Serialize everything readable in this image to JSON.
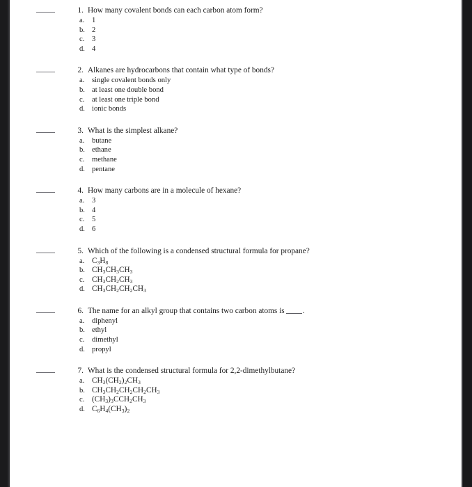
{
  "document": {
    "type": "multiple-choice-worksheet",
    "subject_hint": "organic chemistry — alkanes and alkyl groups",
    "page_background": "#ffffff",
    "text_color": "#1a1a1a",
    "scan_border_color": "#1b1b1d"
  },
  "questions": [
    {
      "number": "1.",
      "text": "How many covalent bonds can each carbon atom form?",
      "has_trailing_blank": false,
      "options": [
        {
          "letter": "a.",
          "text": "1",
          "is_formula": false
        },
        {
          "letter": "b.",
          "text": "2",
          "is_formula": false
        },
        {
          "letter": "c.",
          "text": "3",
          "is_formula": false
        },
        {
          "letter": "d.",
          "text": "4",
          "is_formula": false
        }
      ]
    },
    {
      "number": "2.",
      "text": "Alkanes are hydrocarbons that contain what type of bonds?",
      "has_trailing_blank": false,
      "options": [
        {
          "letter": "a.",
          "text": "single covalent bonds only",
          "is_formula": false
        },
        {
          "letter": "b.",
          "text": "at least one double bond",
          "is_formula": false
        },
        {
          "letter": "c.",
          "text": "at least one triple bond",
          "is_formula": false
        },
        {
          "letter": "d.",
          "text": "ionic bonds",
          "is_formula": false
        }
      ]
    },
    {
      "number": "3.",
      "text": "What is the simplest alkane?",
      "has_trailing_blank": false,
      "options": [
        {
          "letter": "a.",
          "text": "butane",
          "is_formula": false
        },
        {
          "letter": "b.",
          "text": "ethane",
          "is_formula": false
        },
        {
          "letter": "c.",
          "text": "methane",
          "is_formula": false
        },
        {
          "letter": "d.",
          "text": "pentane",
          "is_formula": false
        }
      ]
    },
    {
      "number": "4.",
      "text": "How many carbons are in a molecule of hexane?",
      "has_trailing_blank": false,
      "options": [
        {
          "letter": "a.",
          "text": "3",
          "is_formula": false
        },
        {
          "letter": "b.",
          "text": "4",
          "is_formula": false
        },
        {
          "letter": "c.",
          "text": "5",
          "is_formula": false
        },
        {
          "letter": "d.",
          "text": "6",
          "is_formula": false
        }
      ]
    },
    {
      "number": "5.",
      "text": "Which of the following is a condensed structural formula for propane?",
      "has_trailing_blank": false,
      "options": [
        {
          "letter": "a.",
          "text": "C3H8",
          "is_formula": true,
          "html": "C<sub>3</sub>H<sub>8</sub>"
        },
        {
          "letter": "b.",
          "text": "CH3CH3CH3",
          "is_formula": true,
          "html": "CH<sub>3</sub>CH<sub>3</sub>CH<sub>3</sub>"
        },
        {
          "letter": "c.",
          "text": "CH3CH2CH3",
          "is_formula": true,
          "html": "CH<sub>3</sub>CH<sub>2</sub>CH<sub>3</sub>"
        },
        {
          "letter": "d.",
          "text": "CH3CH2CH2CH3",
          "is_formula": true,
          "html": "CH<sub>3</sub>CH<sub>2</sub>CH<sub>2</sub>CH<sub>3</sub>"
        }
      ]
    },
    {
      "number": "6.",
      "text": "The name for an alkyl group that contains two carbon atoms is",
      "has_trailing_blank": true,
      "trailing_punctuation": ".",
      "options": [
        {
          "letter": "a.",
          "text": "diphenyl",
          "is_formula": false
        },
        {
          "letter": "b.",
          "text": "ethyl",
          "is_formula": false
        },
        {
          "letter": "c.",
          "text": "dimethyl",
          "is_formula": false
        },
        {
          "letter": "d.",
          "text": "propyl",
          "is_formula": false
        }
      ]
    },
    {
      "number": "7.",
      "text": "What is the condensed structural formula for 2,2-dimethylbutane?",
      "has_trailing_blank": false,
      "options": [
        {
          "letter": "a.",
          "text": "CH3(CH2)2CH3",
          "is_formula": true,
          "html": "CH<sub>3</sub>(CH<sub>2</sub>)<sub>2</sub>CH<sub>3</sub>"
        },
        {
          "letter": "b.",
          "text": "CH3CH2CH2CH2CH3",
          "is_formula": true,
          "html": "CH<sub>3</sub>CH<sub>2</sub>CH<sub>2</sub>CH<sub>2</sub>CH<sub>3</sub>"
        },
        {
          "letter": "c.",
          "text": "(CH3)3CCH2CH3",
          "is_formula": true,
          "html": "(CH<sub>3</sub>)<sub>3</sub>CCH<sub>2</sub>CH<sub>3</sub>"
        },
        {
          "letter": "d.",
          "text": "C6H4(CH3)2",
          "is_formula": true,
          "html": "C<sub>6</sub>H<sub>4</sub>(CH<sub>3</sub>)<sub>2</sub>"
        }
      ]
    }
  ]
}
